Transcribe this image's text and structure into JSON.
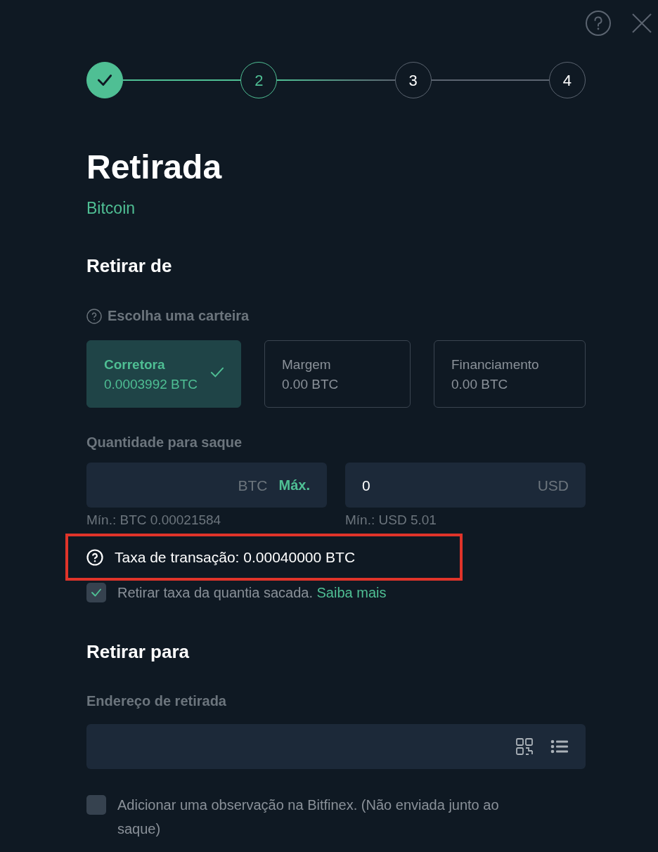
{
  "steps": [
    {
      "done": true,
      "selected": false
    },
    {
      "label": "2",
      "done": false,
      "selected": true
    },
    {
      "label": "3",
      "done": false,
      "selected": false
    },
    {
      "label": "4",
      "done": false,
      "selected": false
    }
  ],
  "title": "Retirada",
  "subtitle": "Bitcoin",
  "from_section": {
    "heading": "Retirar de",
    "wallet_label": "Escolha uma carteira",
    "wallets": [
      {
        "name": "Corretora",
        "balance": "0.0003992 BTC",
        "selected": true
      },
      {
        "name": "Margem",
        "balance": "0.00 BTC",
        "selected": false
      },
      {
        "name": "Financiamento",
        "balance": "0.00 BTC",
        "selected": false
      }
    ]
  },
  "amount": {
    "label": "Quantidade para saque",
    "btc_field": {
      "unit": "BTC",
      "max_link": "Máx.",
      "min": "Mín.: BTC 0.00021584"
    },
    "usd_field": {
      "value": "0",
      "unit": "USD",
      "min": "Mín.: USD 5.01"
    }
  },
  "fee": {
    "text": "Taxa de transação: 0.00040000 BTC",
    "highlighted": true
  },
  "deduct_fee": {
    "label": "Retirar taxa da quantia sacada.",
    "link": "Saiba mais",
    "checked": true
  },
  "to_section": {
    "heading": "Retirar para",
    "address_label": "Endereço de retirada"
  },
  "memo": {
    "label": "Adicionar uma observação na Bitfinex. (Não enviada junto ao saque)",
    "checked": false
  }
}
